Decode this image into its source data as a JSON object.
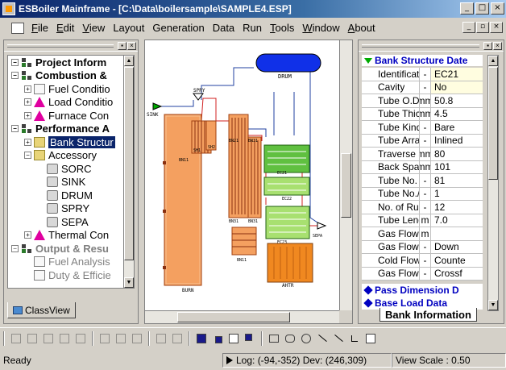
{
  "window": {
    "title": "ESBoiler Mainframe - [C:\\Data\\boilersample\\SAMPLE4.ESP]",
    "controls": [
      "_",
      "□",
      "×"
    ]
  },
  "menu": {
    "items": [
      {
        "label": "File",
        "mnemonic": "F",
        "rest": "ile"
      },
      {
        "label": "Edit",
        "mnemonic": "E",
        "rest": "dit"
      },
      {
        "label": "View",
        "mnemonic": "V",
        "rest": "iew"
      },
      {
        "label": "Layout",
        "mnemonic": "",
        "rest": "Layout"
      },
      {
        "label": "Generation",
        "mnemonic": "",
        "rest": "Generation"
      },
      {
        "label": "Data",
        "mnemonic": "",
        "rest": "Data"
      },
      {
        "label": "Run",
        "mnemonic": "",
        "rest": "Run"
      },
      {
        "label": "Tools",
        "mnemonic": "T",
        "rest": "ools"
      },
      {
        "label": "Window",
        "mnemonic": "W",
        "rest": "indow"
      },
      {
        "label": "About",
        "mnemonic": "A",
        "rest": "bout"
      }
    ],
    "mdi_controls": [
      "_",
      "▫",
      "×"
    ]
  },
  "tree": {
    "rows": [
      {
        "level": 0,
        "exp": "−",
        "icon": "net",
        "label": "Project Inform",
        "style": "bold"
      },
      {
        "level": 0,
        "exp": "−",
        "icon": "net",
        "label": "Combustion &",
        "style": "bold"
      },
      {
        "level": 1,
        "exp": "+",
        "icon": "doc",
        "label": "Fuel Conditio",
        "style": ""
      },
      {
        "level": 1,
        "exp": "+",
        "icon": "warn",
        "label": "Load Conditio",
        "style": ""
      },
      {
        "level": 1,
        "exp": "+",
        "icon": "warn",
        "label": "Furnace Con",
        "style": ""
      },
      {
        "level": 0,
        "exp": "−",
        "icon": "net",
        "label": "Performance A",
        "style": "bold"
      },
      {
        "level": 1,
        "exp": "+",
        "icon": "folder",
        "label": "Bank Structur",
        "style": "selected"
      },
      {
        "level": 1,
        "exp": "−",
        "icon": "folder",
        "label": "Accessory",
        "style": ""
      },
      {
        "level": 2,
        "exp": "",
        "icon": "item",
        "label": "SORC",
        "style": ""
      },
      {
        "level": 2,
        "exp": "",
        "icon": "item",
        "label": "SINK",
        "style": ""
      },
      {
        "level": 2,
        "exp": "",
        "icon": "item",
        "label": "DRUM",
        "style": ""
      },
      {
        "level": 2,
        "exp": "",
        "icon": "item",
        "label": "SPRY",
        "style": ""
      },
      {
        "level": 2,
        "exp": "",
        "icon": "item",
        "label": "SEPA",
        "style": ""
      },
      {
        "level": 1,
        "exp": "+",
        "icon": "warn",
        "label": "Thermal Con",
        "style": ""
      },
      {
        "level": 0,
        "exp": "−",
        "icon": "net",
        "label": "Output & Resu",
        "style": "bold gray"
      },
      {
        "level": 1,
        "exp": "",
        "icon": "doc",
        "label": "Fuel Analysis",
        "style": "gray"
      },
      {
        "level": 1,
        "exp": "",
        "icon": "doc",
        "label": "Duty & Efficie",
        "style": "gray"
      }
    ]
  },
  "left_tab": {
    "label": "ClassView"
  },
  "canvas": {
    "labels": {
      "drum": "DRUM",
      "sink": "SINK",
      "spry": "SPRY",
      "sh1": "SH1",
      "sh2": "SH2",
      "bn1": "BN11",
      "bn21": "BN21",
      "bn31": "BN31",
      "bn31b": "BN31",
      "bn31c": "BN31",
      "bn11": "BN11",
      "ec21": "EC21",
      "ec22": "EC22",
      "ec23": "EC23",
      "sepa": "SEPA",
      "burn": "BURN",
      "ahtr": "AHTR"
    }
  },
  "properties": {
    "title": "Bank Structure Date",
    "rows": [
      {
        "name": "Identificatio",
        "unit": "-",
        "value": "EC21",
        "edited": true
      },
      {
        "name": "Cavity",
        "unit": "-",
        "value": "No",
        "edited": true
      },
      {
        "name": "Tube O.D.",
        "unit": "mm",
        "value": "50.8",
        "edited": false
      },
      {
        "name": "Tube Thickn",
        "unit": "mm",
        "value": "4.5",
        "edited": false
      },
      {
        "name": "Tube Kinds",
        "unit": "-",
        "value": "Bare",
        "edited": false
      },
      {
        "name": "Tube Arrang",
        "unit": "-",
        "value": "Inlined",
        "edited": false
      },
      {
        "name": "Traverse Sp",
        "unit": "mm",
        "value": "80",
        "edited": false
      },
      {
        "name": "Back Spacing",
        "unit": "mm",
        "value": "101",
        "edited": false
      },
      {
        "name": "Tube No. W",
        "unit": "-",
        "value": "81",
        "edited": false
      },
      {
        "name": "Tube No./Ru",
        "unit": "-",
        "value": "1",
        "edited": false
      },
      {
        "name": "No. of Run",
        "unit": "-",
        "value": "12",
        "edited": false
      },
      {
        "name": "Tube Lengt",
        "unit": "m",
        "value": "7.0",
        "edited": false
      },
      {
        "name": "Gas Flow H",
        "unit": "m",
        "value": "",
        "edited": false
      },
      {
        "name": "Gas Flow D",
        "unit": "-",
        "value": "Down",
        "edited": false
      },
      {
        "name": "Cold Flow P",
        "unit": "-",
        "value": "Counte",
        "edited": false
      },
      {
        "name": "Gas Flow P",
        "unit": "-",
        "value": "Crossf",
        "edited": false
      }
    ],
    "sections": [
      "Pass Dimension D",
      "Base Load Data"
    ],
    "tab": "Bank Information"
  },
  "status": {
    "ready": "Ready",
    "log": "Log: (-94,-352) Dev: (246,309)",
    "view_scale": "View Scale : 0.50"
  }
}
